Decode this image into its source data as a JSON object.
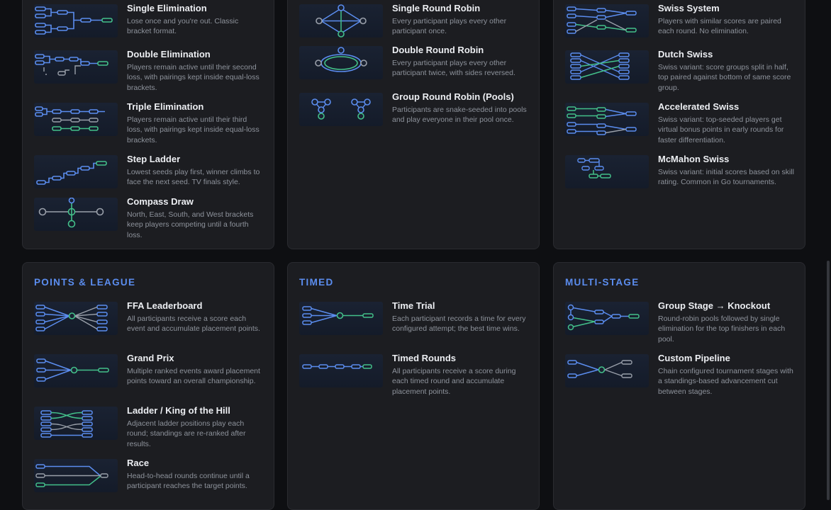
{
  "columns": [
    {
      "entries": [
        {
          "name": "Single Elimination",
          "desc": "Lose once and you're out. Classic bracket format."
        },
        {
          "name": "Double Elimination",
          "desc": "Players remain active until their second loss, with pairings kept inside equal-loss brackets."
        },
        {
          "name": "Triple Elimination",
          "desc": "Players remain active until their third loss, with pairings kept inside equal-loss brackets."
        },
        {
          "name": "Step Ladder",
          "desc": "Lowest seeds play first, winner climbs to face the next seed. TV finals style."
        },
        {
          "name": "Compass Draw",
          "desc": "North, East, South, and West brackets keep players competing until a fourth loss."
        }
      ]
    },
    {
      "entries": [
        {
          "name": "Single Round Robin",
          "desc": "Every participant plays every other participant once."
        },
        {
          "name": "Double Round Robin",
          "desc": "Every participant plays every other participant twice, with sides reversed."
        },
        {
          "name": "Group Round Robin (Pools)",
          "desc": "Participants are snake-seeded into pools and play everyone in their pool once."
        }
      ]
    },
    {
      "entries": [
        {
          "name": "Swiss System",
          "desc": "Players with similar scores are paired each round. No elimination."
        },
        {
          "name": "Dutch Swiss",
          "desc": "Swiss variant: score groups split in half, top paired against bottom of same score group."
        },
        {
          "name": "Accelerated Swiss",
          "desc": "Swiss variant: top-seeded players get virtual bonus points in early rounds for faster differentiation."
        },
        {
          "name": "McMahon Swiss",
          "desc": "Swiss variant: initial scores based on skill rating. Common in Go tournaments."
        }
      ]
    },
    {
      "title": "POINTS & LEAGUE",
      "entries": [
        {
          "name": "FFA Leaderboard",
          "desc": "All participants receive a score each event and accumulate placement points."
        },
        {
          "name": "Grand Prix",
          "desc": "Multiple ranked events award placement points toward an overall championship."
        },
        {
          "name": "Ladder / King of the Hill",
          "desc": "Adjacent ladder positions play each round; standings are re-ranked after results."
        },
        {
          "name": "Race",
          "desc": "Head-to-head rounds continue until a participant reaches the target points."
        }
      ]
    },
    {
      "title": "TIMED",
      "entries": [
        {
          "name": "Time Trial",
          "desc": "Each participant records a time for every configured attempt; the best time wins."
        },
        {
          "name": "Timed Rounds",
          "desc": "All participants receive a score during each timed round and accumulate placement points."
        }
      ]
    },
    {
      "title": "MULTI-STAGE",
      "entries": [
        {
          "name": "Group Stage → Knockout",
          "desc": "Round-robin pools followed by single elimination for the top finishers in each pool."
        },
        {
          "name": "Custom Pipeline",
          "desc": "Chain configured tournament stages with a standings-based advancement cut between stages."
        }
      ]
    }
  ],
  "colors": {
    "blue": "#5b8def",
    "green": "#43c08a",
    "gray": "#9aa0aa",
    "accent": "#5b8def"
  }
}
